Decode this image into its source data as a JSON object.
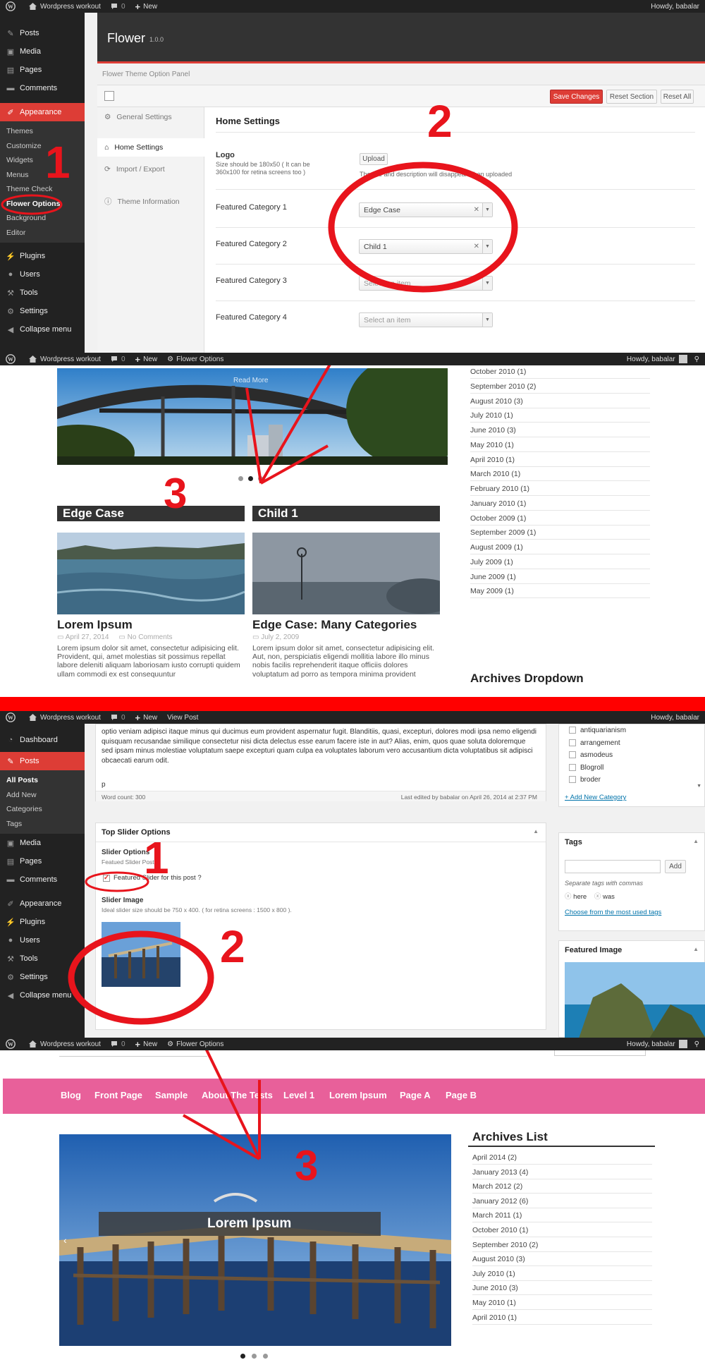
{
  "admin_bar": {
    "site_name": "Wordpress workout",
    "comments_count": "0",
    "new_label": "New",
    "view_post_label": "View Post",
    "theme_options_label": "Flower Options",
    "howdy": "Howdy, babalar"
  },
  "panel1": {
    "menu": {
      "items_top": [
        "Posts",
        "Media",
        "Pages",
        "Comments"
      ],
      "appearance": "Appearance",
      "appearance_sub": [
        "Themes",
        "Customize",
        "Widgets",
        "Menus",
        "Theme Check",
        "Flower Options",
        "Background",
        "Editor"
      ],
      "items_bottom": [
        "Plugins",
        "Users",
        "Tools",
        "Settings",
        "Collapse menu"
      ]
    },
    "theme_title": "Flower",
    "theme_version": "1.0.0",
    "panel_label": "Flower Theme Option Panel",
    "buttons": {
      "save": "Save Changes",
      "reset_section": "Reset Section",
      "reset_all": "Reset All"
    },
    "tabs": [
      "General Settings",
      "Home Settings",
      "Import / Export",
      "Theme Information"
    ],
    "section_title": "Home Settings",
    "logo": {
      "label": "Logo",
      "hint": "Size should be 180x50 ( It can be 360x100 for retina screens too )",
      "upload": "Upload",
      "note": "The title and description will disappear when uploaded"
    },
    "featured": [
      {
        "label": "Featured Category 1",
        "value": "Edge Case"
      },
      {
        "label": "Featured Category 2",
        "value": "Child 1"
      },
      {
        "label": "Featured Category 3",
        "placeholder": "Select an item"
      },
      {
        "label": "Featured Category 4",
        "placeholder": "Select an item"
      }
    ],
    "annotations": [
      "1",
      "2"
    ]
  },
  "panel2": {
    "slider_read_more": "Read More",
    "categories": [
      "Edge Case",
      "Child 1"
    ],
    "posts": [
      {
        "title": "Lorem Ipsum",
        "date": "April 27, 2014",
        "comments": "No Comments",
        "excerpt": "Lorem ipsum dolor sit amet, consectetur adipisicing elit. Provident, qui, amet molestias sit possimus repellat labore deleniti aliquam laboriosam iusto corrupti quidem ullam commodi ex est consequuntur"
      },
      {
        "title": "Edge Case: Many Categories",
        "date": "July 2, 2009",
        "excerpt": "Lorem ipsum dolor sit amet, consectetur adipisicing elit. Aut, non, perspiciatis eligendi mollitia labore illo minus nobis facilis reprehenderit itaque officiis dolores voluptatum ad porro as tempora minima provident"
      }
    ],
    "archives": [
      "October 2010 (1)",
      "September 2010 (2)",
      "August 2010 (3)",
      "July 2010 (1)",
      "June 2010 (3)",
      "May 2010 (1)",
      "April 2010 (1)",
      "March 2010 (1)",
      "February 2010 (1)",
      "January 2010 (1)",
      "October 2009 (1)",
      "September 2009 (1)",
      "August 2009 (1)",
      "July 2009 (1)",
      "June 2009 (1)",
      "May 2009 (1)"
    ],
    "archives_dropdown_title": "Archives Dropdown",
    "annotation": "3"
  },
  "panel3": {
    "menu": {
      "dashboard": "Dashboard",
      "posts": "Posts",
      "posts_sub": [
        "All Posts",
        "Add New",
        "Categories",
        "Tags"
      ],
      "items": [
        "Media",
        "Pages",
        "Comments",
        "Appearance",
        "Plugins",
        "Users",
        "Tools",
        "Settings",
        "Collapse menu"
      ]
    },
    "editor_text": "optio veniam adipisci itaque minus qui ducimus eum provident aspernatur fugit. Blanditiis, quasi, excepturi, dolores modi ipsa nemo eligendi quisquam recusandae similique consectetur nisi dicta delectus esse earum facere iste in aut? Alias, enim, quos quae soluta doloremque sed ipsam minus molestiae voluptatum saepe excepturi quam culpa ea voluptates laborum vero accusantium dicta voluptatibus sit adipisci obcaecati earum odit.",
    "path": "p",
    "word_count": "Word count: 300",
    "last_edited": "Last edited by babalar on April 26, 2014 at 2:37 PM",
    "slider_box": {
      "title": "Top Slider Options",
      "options_label": "Slider Options",
      "options_hint": "Featued Slider Post",
      "checkbox_label": "Featured Slider for this post ?",
      "image_label": "Slider Image",
      "image_hint": "Ideal slider size should be 750 x 400. ( for retina screens : 1500 x 800 )."
    },
    "categories": [
      "antiquarianism",
      "arrangement",
      "asmodeus",
      "Blogroll",
      "broder"
    ],
    "add_category": "+ Add New Category",
    "tags": {
      "title": "Tags",
      "add": "Add",
      "hint": "Separate tags with commas",
      "items": [
        "here",
        "was"
      ],
      "choose": "Choose from the most used tags"
    },
    "featured_image_title": "Featured Image",
    "annotations": [
      "1",
      "2"
    ]
  },
  "panel4": {
    "nav": [
      "Blog",
      "Front Page",
      "Sample",
      "About The Tests",
      "Level 1",
      "Lorem Ipsum",
      "Page A",
      "Page B"
    ],
    "nav_color": "#e8609a",
    "slide_caption": "Lorem Ipsum",
    "archives_title": "Archives List",
    "archives": [
      "April 2014 (2)",
      "January 2013 (4)",
      "March 2012 (2)",
      "January 2012 (6)",
      "March 2011 (1)",
      "October 2010 (1)",
      "September 2010 (2)",
      "August 2010 (3)",
      "July 2010 (1)",
      "June 2010 (3)",
      "May 2010 (1)",
      "April 2010 (1)"
    ],
    "annotation": "3"
  },
  "colors": {
    "accent_red": "#dd3d36",
    "annotation_red": "#e8141c",
    "admin_dark": "#222222"
  }
}
